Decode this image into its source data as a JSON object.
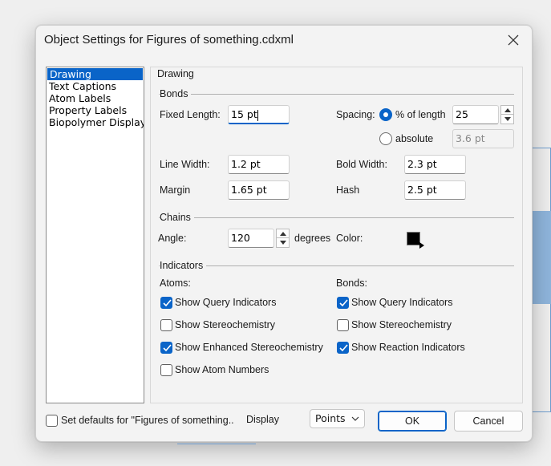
{
  "window": {
    "title": "Object Settings for Figures of something.cdxml"
  },
  "sidebar": {
    "items": [
      {
        "label": "Drawing",
        "selected": true
      },
      {
        "label": "Text Captions"
      },
      {
        "label": "Atom Labels"
      },
      {
        "label": "Property Labels"
      },
      {
        "label": "Biopolymer Display"
      }
    ]
  },
  "panel": {
    "title": "Drawing",
    "bonds": {
      "group_label": "Bonds",
      "fixed_length_label": "Fixed Length:",
      "fixed_length_value": "15 pt",
      "spacing_label": "Spacing:",
      "spacing_percent_label": "% of length",
      "spacing_percent_value": "25",
      "spacing_percent_selected": true,
      "spacing_absolute_label": "absolute",
      "spacing_absolute_value": "3.6 pt",
      "line_width_label": "Line Width:",
      "line_width_value": "1.2 pt",
      "bold_width_label": "Bold Width:",
      "bold_width_value": "2.3 pt",
      "margin_label": "Margin",
      "margin_value": "1.65 pt",
      "hash_label": "Hash",
      "hash_value": "2.5 pt"
    },
    "chains": {
      "group_label": "Chains",
      "angle_label": "Angle:",
      "angle_value": "120",
      "angle_unit": "degrees",
      "color_label": "Color:",
      "color_value": "#000000"
    },
    "indicators": {
      "group_label": "Indicators",
      "atoms_label": "Atoms:",
      "bonds_label": "Bonds:",
      "atoms": [
        {
          "label": "Show Query Indicators",
          "checked": true
        },
        {
          "label": "Show Stereochemistry",
          "checked": false
        },
        {
          "label": "Show Enhanced Stereochemistry",
          "checked": true
        },
        {
          "label": "Show Atom Numbers",
          "checked": false
        }
      ],
      "bonds": [
        {
          "label": "Show Query Indicators",
          "checked": true
        },
        {
          "label": "Show Stereochemistry",
          "checked": false
        },
        {
          "label": "Show Reaction Indicators",
          "checked": true
        }
      ]
    }
  },
  "footer": {
    "defaults_label": "Set defaults for \"Figures of something..",
    "defaults_checked": false,
    "display_label": "Display",
    "units_value": "Points",
    "ok_label": "OK",
    "cancel_label": "Cancel"
  },
  "colors": {
    "accent": "#0a64c8"
  }
}
